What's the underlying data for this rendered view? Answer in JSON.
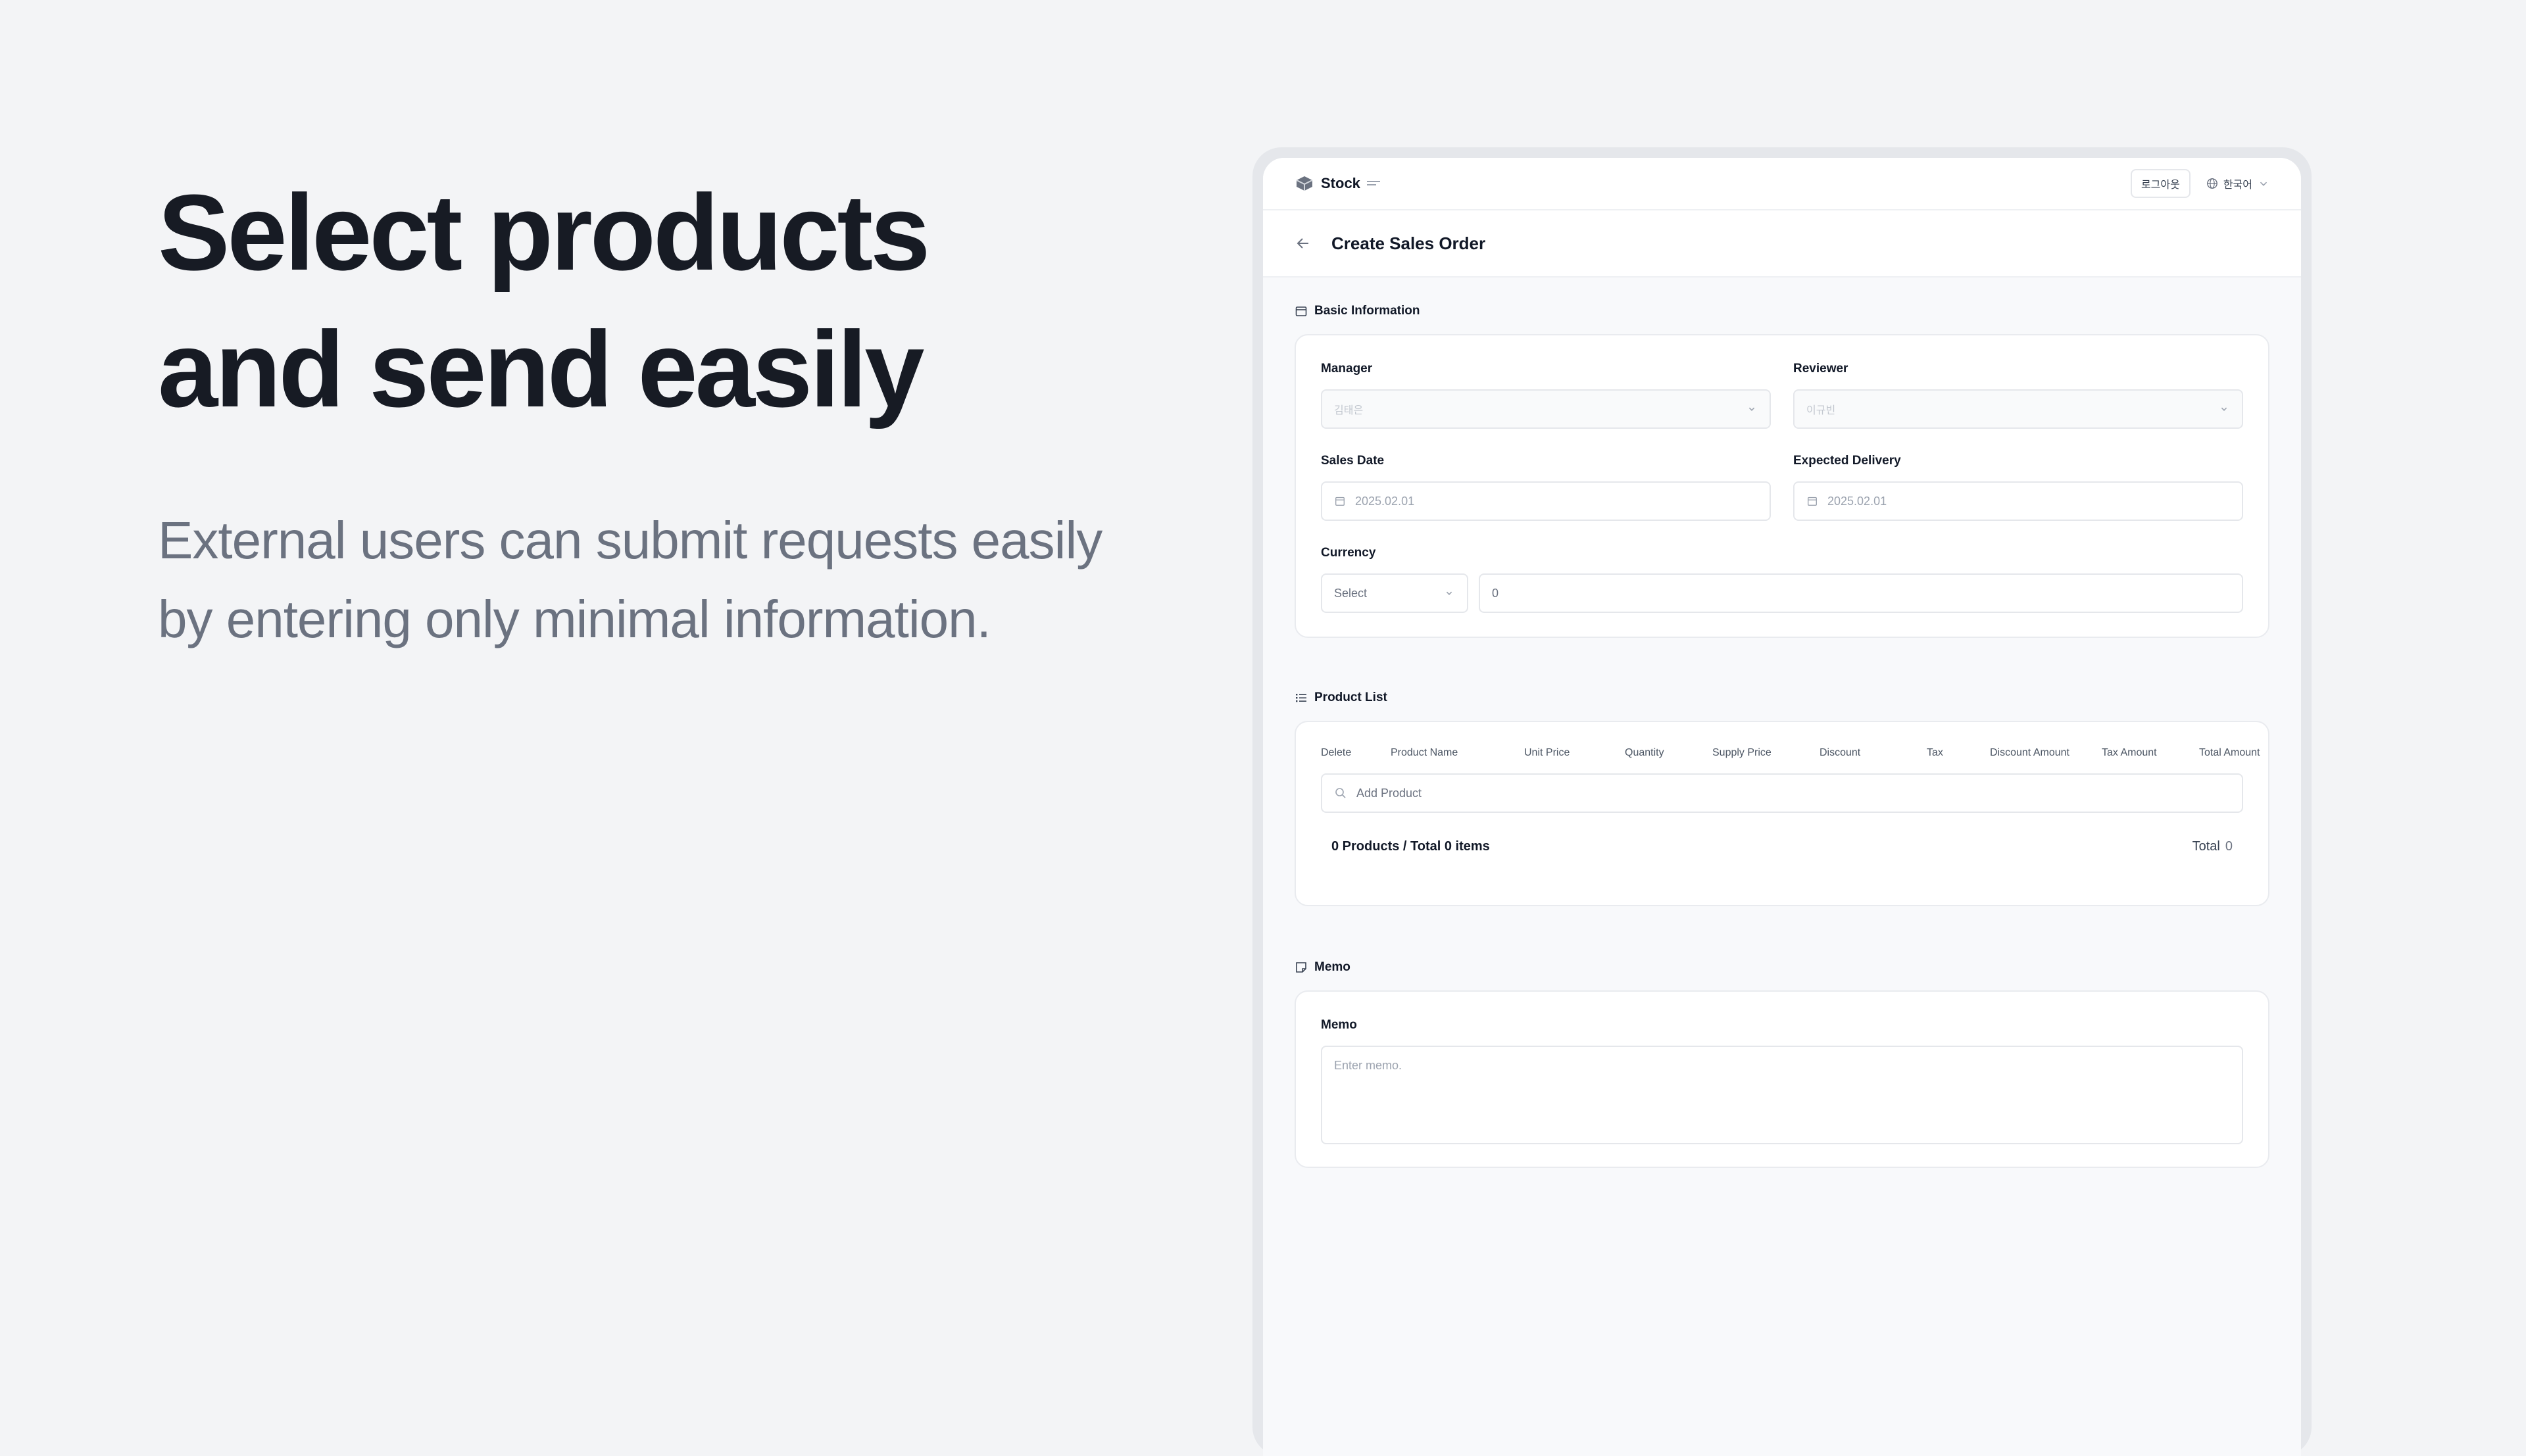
{
  "hero": {
    "title_line1": "Select products",
    "title_line2": "and send easily",
    "subtitle_line1": "External users can submit requests easily",
    "subtitle_line2": "by entering only minimal information."
  },
  "app": {
    "logo_text": "Stock",
    "logout_label": "로그아웃",
    "language_label": "한국어",
    "page_title": "Create Sales Order"
  },
  "basic_info": {
    "section_title": "Basic Information",
    "manager": {
      "label": "Manager",
      "value": "김태은"
    },
    "reviewer": {
      "label": "Reviewer",
      "value": "이규빈"
    },
    "sales_date": {
      "label": "Sales Date",
      "value": "2025.02.01"
    },
    "expected_delivery": {
      "label": "Expected Delivery",
      "value": "2025.02.01"
    },
    "currency": {
      "label": "Currency",
      "select_value": "Select",
      "amount_value": "0"
    }
  },
  "product_list": {
    "section_title": "Product List",
    "columns": [
      "Delete",
      "Product Name",
      "Unit Price",
      "Quantity",
      "Supply Price",
      "Discount",
      "Tax",
      "Discount Amount",
      "Tax Amount",
      "Total Amount"
    ],
    "add_product_placeholder": "Add Product",
    "summary_text": "0 Products / Total 0 items",
    "total_label": "Total",
    "total_value": "0"
  },
  "memo": {
    "section_title": "Memo",
    "label": "Memo",
    "placeholder": "Enter memo."
  },
  "colors": {
    "page_bg": "#f3f4f6",
    "title": "#171b24",
    "subtitle": "#6b7280"
  },
  "icons": [
    "logo-icon",
    "globe-icon",
    "chevron-down-icon",
    "back-arrow-icon",
    "calendar-icon",
    "list-icon",
    "memo-icon",
    "search-icon"
  ]
}
